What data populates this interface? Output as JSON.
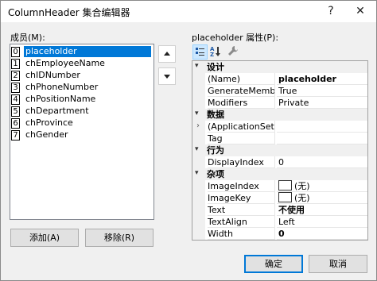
{
  "window": {
    "title": "ColumnHeader 集合编辑器",
    "help_glyph": "?",
    "close_glyph": "✕"
  },
  "members": {
    "label": "成员(M):",
    "items": [
      {
        "index": "0",
        "name": "placeholder",
        "selected": true
      },
      {
        "index": "1",
        "name": "chEmployeeName",
        "selected": false
      },
      {
        "index": "2",
        "name": "chIDNumber",
        "selected": false
      },
      {
        "index": "3",
        "name": "chPhoneNumber",
        "selected": false
      },
      {
        "index": "4",
        "name": "chPositionName",
        "selected": false
      },
      {
        "index": "5",
        "name": "chDepartment",
        "selected": false
      },
      {
        "index": "6",
        "name": "chProvince",
        "selected": false
      },
      {
        "index": "7",
        "name": "chGender",
        "selected": false
      }
    ],
    "move_up_icon": "arrow-up-icon",
    "move_down_icon": "arrow-down-icon",
    "add_label": "添加(A)",
    "remove_label": "移除(R)"
  },
  "properties": {
    "label": "placeholder 属性(P):",
    "toolbar": {
      "categorized_icon": "categorized-icon",
      "alphabetical_icon": "alphabetical-icon",
      "property_pages_icon": "wrench-icon"
    },
    "categories": [
      {
        "name": "设计",
        "rows": [
          {
            "name": "(Name)",
            "value": "placeholder",
            "bold": true
          },
          {
            "name": "GenerateMember",
            "value": "True",
            "bold": false
          },
          {
            "name": "Modifiers",
            "value": "Private",
            "bold": false
          }
        ]
      },
      {
        "name": "数据",
        "rows": [
          {
            "name": "(ApplicationSettin",
            "value": "",
            "bold": false,
            "expandable": true
          },
          {
            "name": "Tag",
            "value": "",
            "bold": false
          }
        ]
      },
      {
        "name": "行为",
        "rows": [
          {
            "name": "DisplayIndex",
            "value": "0",
            "bold": false
          }
        ]
      },
      {
        "name": "杂项",
        "rows": [
          {
            "name": "ImageIndex",
            "value": "(无)",
            "bold": false,
            "swatch": true
          },
          {
            "name": "ImageKey",
            "value": "(无)",
            "bold": false,
            "swatch": true
          },
          {
            "name": "Text",
            "value": "不使用",
            "bold": true
          },
          {
            "name": "TextAlign",
            "value": "Left",
            "bold": false
          },
          {
            "name": "Width",
            "value": "0",
            "bold": true
          }
        ]
      }
    ]
  },
  "footer": {
    "ok_label": "确定",
    "cancel_label": "取消"
  },
  "colors": {
    "selection": "#0078d7",
    "dialog_bg": "#f0f0f0"
  }
}
